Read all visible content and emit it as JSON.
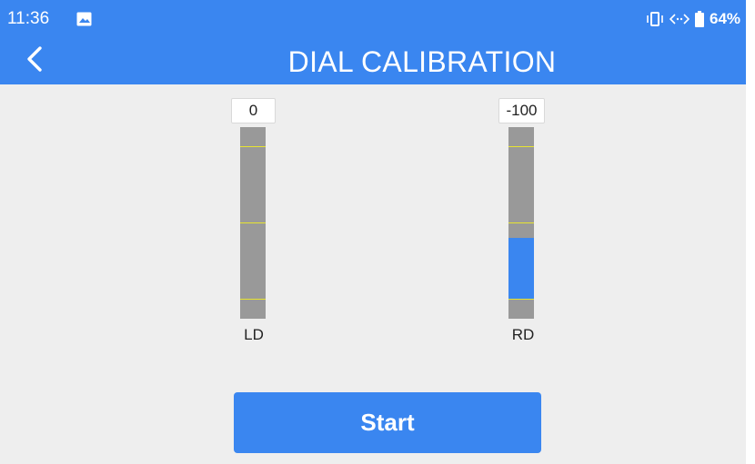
{
  "status_bar": {
    "time": "11:36",
    "battery_percent": "64%",
    "icons": [
      "image-icon",
      "vibrate-icon",
      "data-sync-icon",
      "battery-icon"
    ]
  },
  "header": {
    "back_icon": "chevron-left-icon",
    "title": "DIAL CALIBRATION"
  },
  "dials": [
    {
      "label": "LD",
      "value": "0",
      "fill_from": 0.0,
      "fill_to": 0.0
    },
    {
      "label": "RD",
      "value": "-100",
      "fill_from": 0.0,
      "fill_to": 0.4
    }
  ],
  "start_button": {
    "label": "Start"
  },
  "colors": {
    "accent": "#3a86f0",
    "background": "#eeeeee",
    "track": "#999999",
    "tick": "#e8e430"
  }
}
